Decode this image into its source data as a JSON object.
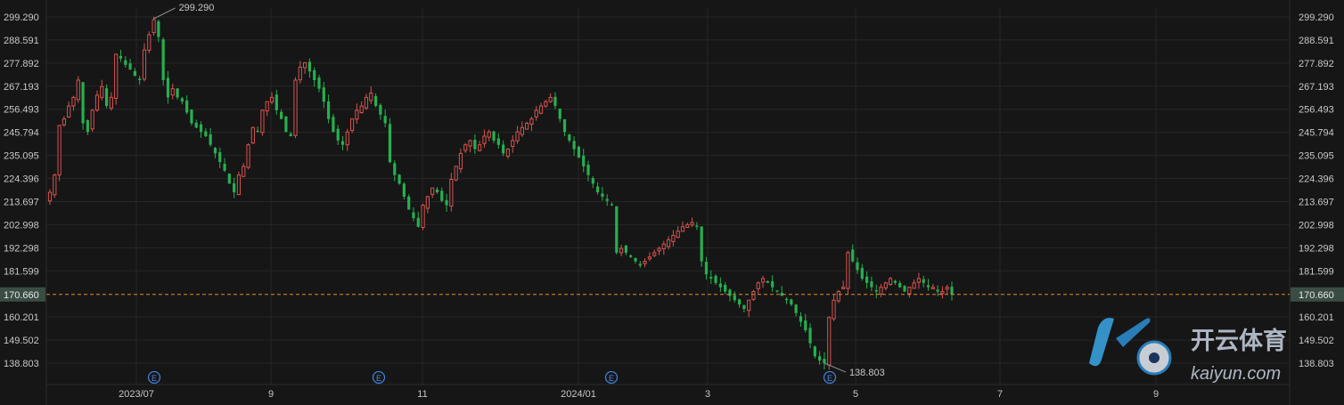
{
  "chart_data": {
    "type": "candlestick",
    "y_ticks": [
      "299.290",
      "288.591",
      "277.892",
      "267.193",
      "256.493",
      "245.794",
      "235.095",
      "224.396",
      "213.697",
      "202.998",
      "192.298",
      "181.599",
      "160.201",
      "149.502",
      "138.803"
    ],
    "ylim": [
      138.803,
      299.29
    ],
    "x_ticks": [
      "2023/07",
      "9",
      "11",
      "2024/01",
      "3",
      "5",
      "7",
      "9"
    ],
    "current_price": "170.660",
    "current_price_value": 170.66,
    "max_label": "299.290",
    "min_label": "138.803",
    "event_marker": "E",
    "up_color": "#d9534f",
    "down_color": "#26b050",
    "current_line_color": "#e38b2c",
    "closes": [
      218,
      226,
      249,
      252,
      258,
      262,
      270,
      250,
      246,
      256,
      263,
      267,
      258,
      262,
      282,
      280,
      277,
      275,
      272,
      270,
      284,
      291,
      298,
      290,
      270,
      262,
      266,
      262,
      260,
      255,
      250,
      248,
      246,
      244,
      240,
      236,
      232,
      228,
      222,
      218,
      226,
      230,
      240,
      248,
      246,
      256,
      260,
      262,
      256,
      252,
      246,
      244,
      270,
      276,
      278,
      274,
      270,
      266,
      260,
      252,
      246,
      242,
      240,
      246,
      252,
      256,
      258,
      262,
      264,
      258,
      254,
      250,
      232,
      226,
      222,
      216,
      210,
      206,
      202,
      212,
      216,
      220,
      218,
      214,
      212,
      224,
      230,
      236,
      240,
      242,
      238,
      240,
      244,
      246,
      242,
      240,
      236,
      238,
      242,
      246,
      248,
      250,
      252,
      256,
      258,
      260,
      262,
      258,
      252,
      246,
      242,
      238,
      234,
      230,
      226,
      222,
      218,
      216,
      214,
      212,
      190,
      192,
      190,
      188,
      186,
      184,
      186,
      188,
      190,
      192,
      194,
      196,
      198,
      200,
      202,
      203,
      204,
      202,
      186,
      180,
      178,
      176,
      174,
      172,
      170,
      168,
      166,
      164,
      168,
      172,
      176,
      178,
      176,
      174,
      172,
      170,
      168,
      166,
      162,
      158,
      154,
      148,
      142,
      140,
      138.8,
      160,
      168,
      172,
      174,
      190,
      186,
      182,
      178,
      176,
      174,
      172,
      174,
      176,
      178,
      176,
      174,
      172,
      174,
      176,
      178,
      176,
      174,
      174,
      172,
      172,
      174,
      170.66
    ],
    "watermark_text": "开云体育",
    "watermark_sub": "kaiyun.com"
  }
}
